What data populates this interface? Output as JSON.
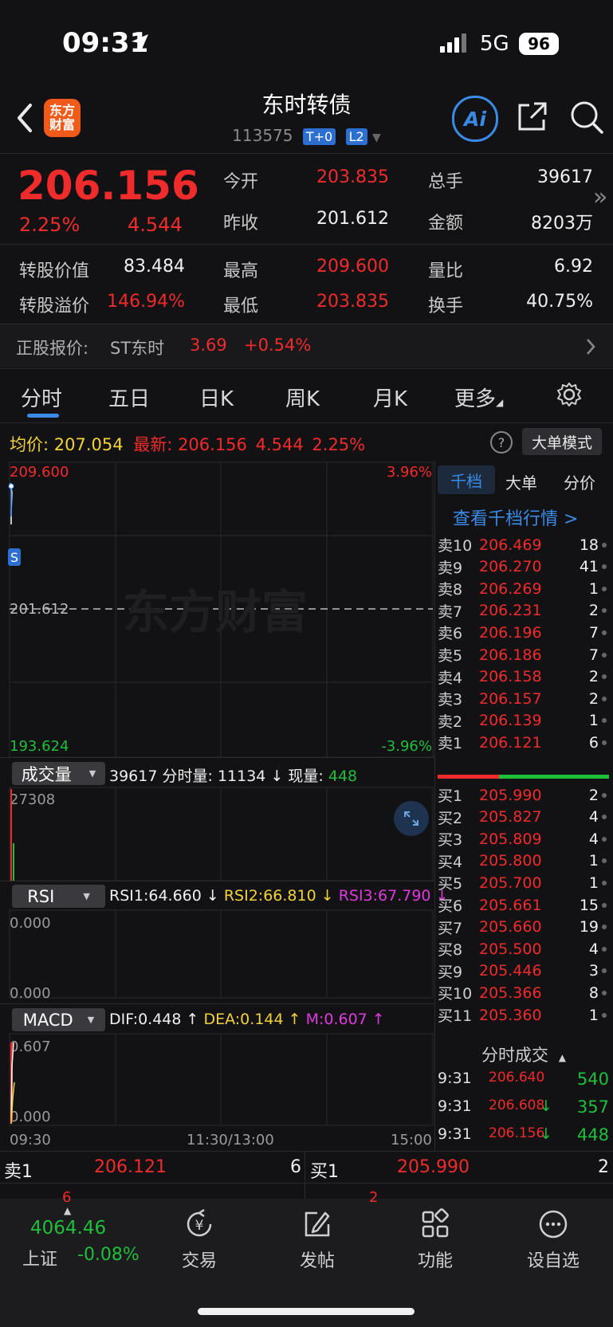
{
  "status_bar": {
    "time": "09:31",
    "network": "5G",
    "battery": "96"
  },
  "header": {
    "title": "东时转债",
    "code": "113575",
    "badges": [
      "T+0",
      "L2"
    ],
    "logo_text_1": "东方",
    "logo_text_2": "财富",
    "ai_label": "Ai"
  },
  "quote": {
    "price": "206.156",
    "pct": "2.25%",
    "change": "4.544",
    "rows": [
      {
        "l1": "今开",
        "v1": "203.835",
        "c1": "red",
        "l2": "总手",
        "v2": "39617",
        "c2": "white"
      },
      {
        "l1": "昨收",
        "v1": "201.612",
        "c1": "white",
        "l2": "金额",
        "v2": "8203万",
        "c2": "white"
      },
      {
        "l1": "最高",
        "v1": "209.600",
        "c1": "red",
        "l2": "量比",
        "v2": "6.92",
        "c2": "white"
      },
      {
        "l1": "最低",
        "v1": "203.835",
        "c1": "red",
        "l2": "换手",
        "v2": "40.75%",
        "c2": "white"
      }
    ],
    "conv_value_label": "转股价值",
    "conv_value": "83.484",
    "conv_premium_label": "转股溢价",
    "conv_premium": "146.94%",
    "stock_label": "正股报价:",
    "stock_name": "ST东时",
    "stock_price": "3.69",
    "stock_change": "+0.54%"
  },
  "tabs": [
    "分时",
    "五日",
    "日K",
    "周K",
    "月K",
    "更多"
  ],
  "active_tab": 0,
  "summary": {
    "avg_label": "均价:",
    "avg_value": "207.054",
    "last_label": "最新:",
    "last_value": "206.156",
    "last_change": "4.544",
    "last_pct": "2.25%",
    "help_icon": "?",
    "mode_button": "大单模式"
  },
  "chart": {
    "top_left": "209.600",
    "top_right": "3.96%",
    "mid_left": "201.612",
    "bottom_left": "193.624",
    "bottom_right": "-3.96%",
    "watermark": "东方财富",
    "marker": "S",
    "time_start": "09:30",
    "time_mid": "11:30/13:00",
    "time_end": "15:00"
  },
  "volume_panel": {
    "selector": "成交量",
    "total": "39617",
    "minute_label": "分时量:",
    "minute_value": "11134",
    "now_label": "现量:",
    "now_value": "448",
    "max": "27308"
  },
  "rsi_panel": {
    "selector": "RSI",
    "rsi1": "RSI1:64.660",
    "rsi2": "RSI2:66.810",
    "rsi3": "RSI3:67.790",
    "top": "0.000",
    "bottom": "0.000"
  },
  "macd_panel": {
    "selector": "MACD",
    "dif": "DIF:0.448",
    "dea": "DEA:0.144",
    "m": "M:0.607",
    "top": "0.607",
    "bottom": "0.000"
  },
  "order_book": {
    "tabs": [
      "千档",
      "大单",
      "分价"
    ],
    "link": "查看千档行情 >",
    "asks": [
      {
        "label": "卖10",
        "price": "206.469",
        "vol": "18"
      },
      {
        "label": "卖9",
        "price": "206.270",
        "vol": "41"
      },
      {
        "label": "卖8",
        "price": "206.269",
        "vol": "1"
      },
      {
        "label": "卖7",
        "price": "206.231",
        "vol": "2"
      },
      {
        "label": "卖6",
        "price": "206.196",
        "vol": "7"
      },
      {
        "label": "卖5",
        "price": "206.186",
        "vol": "7"
      },
      {
        "label": "卖4",
        "price": "206.158",
        "vol": "2"
      },
      {
        "label": "卖3",
        "price": "206.157",
        "vol": "2"
      },
      {
        "label": "卖2",
        "price": "206.139",
        "vol": "1"
      },
      {
        "label": "卖1",
        "price": "206.121",
        "vol": "6"
      }
    ],
    "bids": [
      {
        "label": "买1",
        "price": "205.990",
        "vol": "2"
      },
      {
        "label": "买2",
        "price": "205.827",
        "vol": "4"
      },
      {
        "label": "买3",
        "price": "205.809",
        "vol": "4"
      },
      {
        "label": "买4",
        "price": "205.800",
        "vol": "1"
      },
      {
        "label": "买5",
        "price": "205.700",
        "vol": "1"
      },
      {
        "label": "买6",
        "price": "205.661",
        "vol": "15"
      },
      {
        "label": "买7",
        "price": "205.660",
        "vol": "19"
      },
      {
        "label": "买8",
        "price": "205.500",
        "vol": "4"
      },
      {
        "label": "买9",
        "price": "205.446",
        "vol": "3"
      },
      {
        "label": "买10",
        "price": "205.366",
        "vol": "8"
      },
      {
        "label": "买11",
        "price": "205.360",
        "vol": "1"
      }
    ],
    "ticks_title": "分时成交",
    "ticks": [
      {
        "time": "9:31",
        "price": "206.640",
        "arrow": "",
        "vol": "540"
      },
      {
        "time": "9:31",
        "price": "206.608",
        "arrow": "↓",
        "vol": "357"
      },
      {
        "time": "9:31",
        "price": "206.156",
        "arrow": "↓",
        "vol": "448"
      }
    ]
  },
  "bottom_quote": {
    "sell_label": "卖1",
    "sell_price": "206.121",
    "sell_vol": "6",
    "buy_label": "买1",
    "buy_price": "205.990",
    "buy_vol": "2",
    "sell_peek": "6",
    "buy_peek": "2"
  },
  "bottom_nav": {
    "index_value": "4064.46",
    "index_name": "上证",
    "index_change": "-0.08%",
    "items": [
      "交易",
      "发帖",
      "功能",
      "设自选"
    ]
  },
  "colors": {
    "up": "#f02b2b",
    "down": "#1fbf3b",
    "accent": "#3a8be8",
    "bg": "#121214"
  }
}
